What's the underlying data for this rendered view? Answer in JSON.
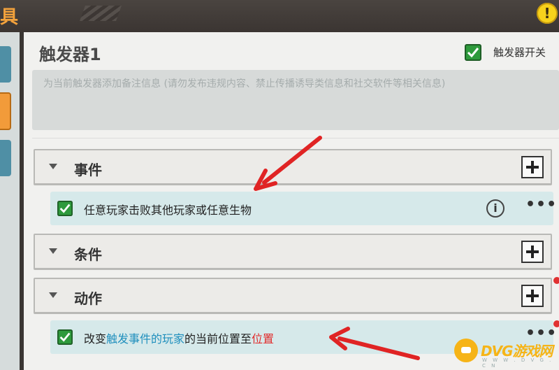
{
  "topbar": {
    "title_fragment": "具",
    "warning_glyph": "!"
  },
  "trigger": {
    "name": "触发器1",
    "toggle_label": "触发器开关",
    "toggle_checked": true
  },
  "note": {
    "placeholder": "为当前触发器添加备注信息 (请勿发布违规内容、禁止传播诱导类信息和社交软件等相关信息)"
  },
  "sections": {
    "event": {
      "label": "事件",
      "expanded": true
    },
    "condition": {
      "label": "条件",
      "expanded": true
    },
    "action": {
      "label": "动作",
      "expanded": true
    }
  },
  "event_row": {
    "checked": true,
    "text": "任意玩家击败其他玩家或任意生物",
    "info_glyph": "i",
    "more_glyph": "•••"
  },
  "action_row": {
    "checked": true,
    "part1": "改变",
    "link1": "触发事件的玩家",
    "part2": "的当前位置至",
    "link2": "位置",
    "more_glyph": "•••"
  },
  "watermark": {
    "brand": "DVG游戏网",
    "domain": "W W W . D V G . C N"
  },
  "colors": {
    "accent_orange": "#f29b3a",
    "link_blue": "#1f8fbd",
    "param_red": "#e12a2a",
    "check_green": "#2e9a3c",
    "arrow_red": "#e02424"
  }
}
